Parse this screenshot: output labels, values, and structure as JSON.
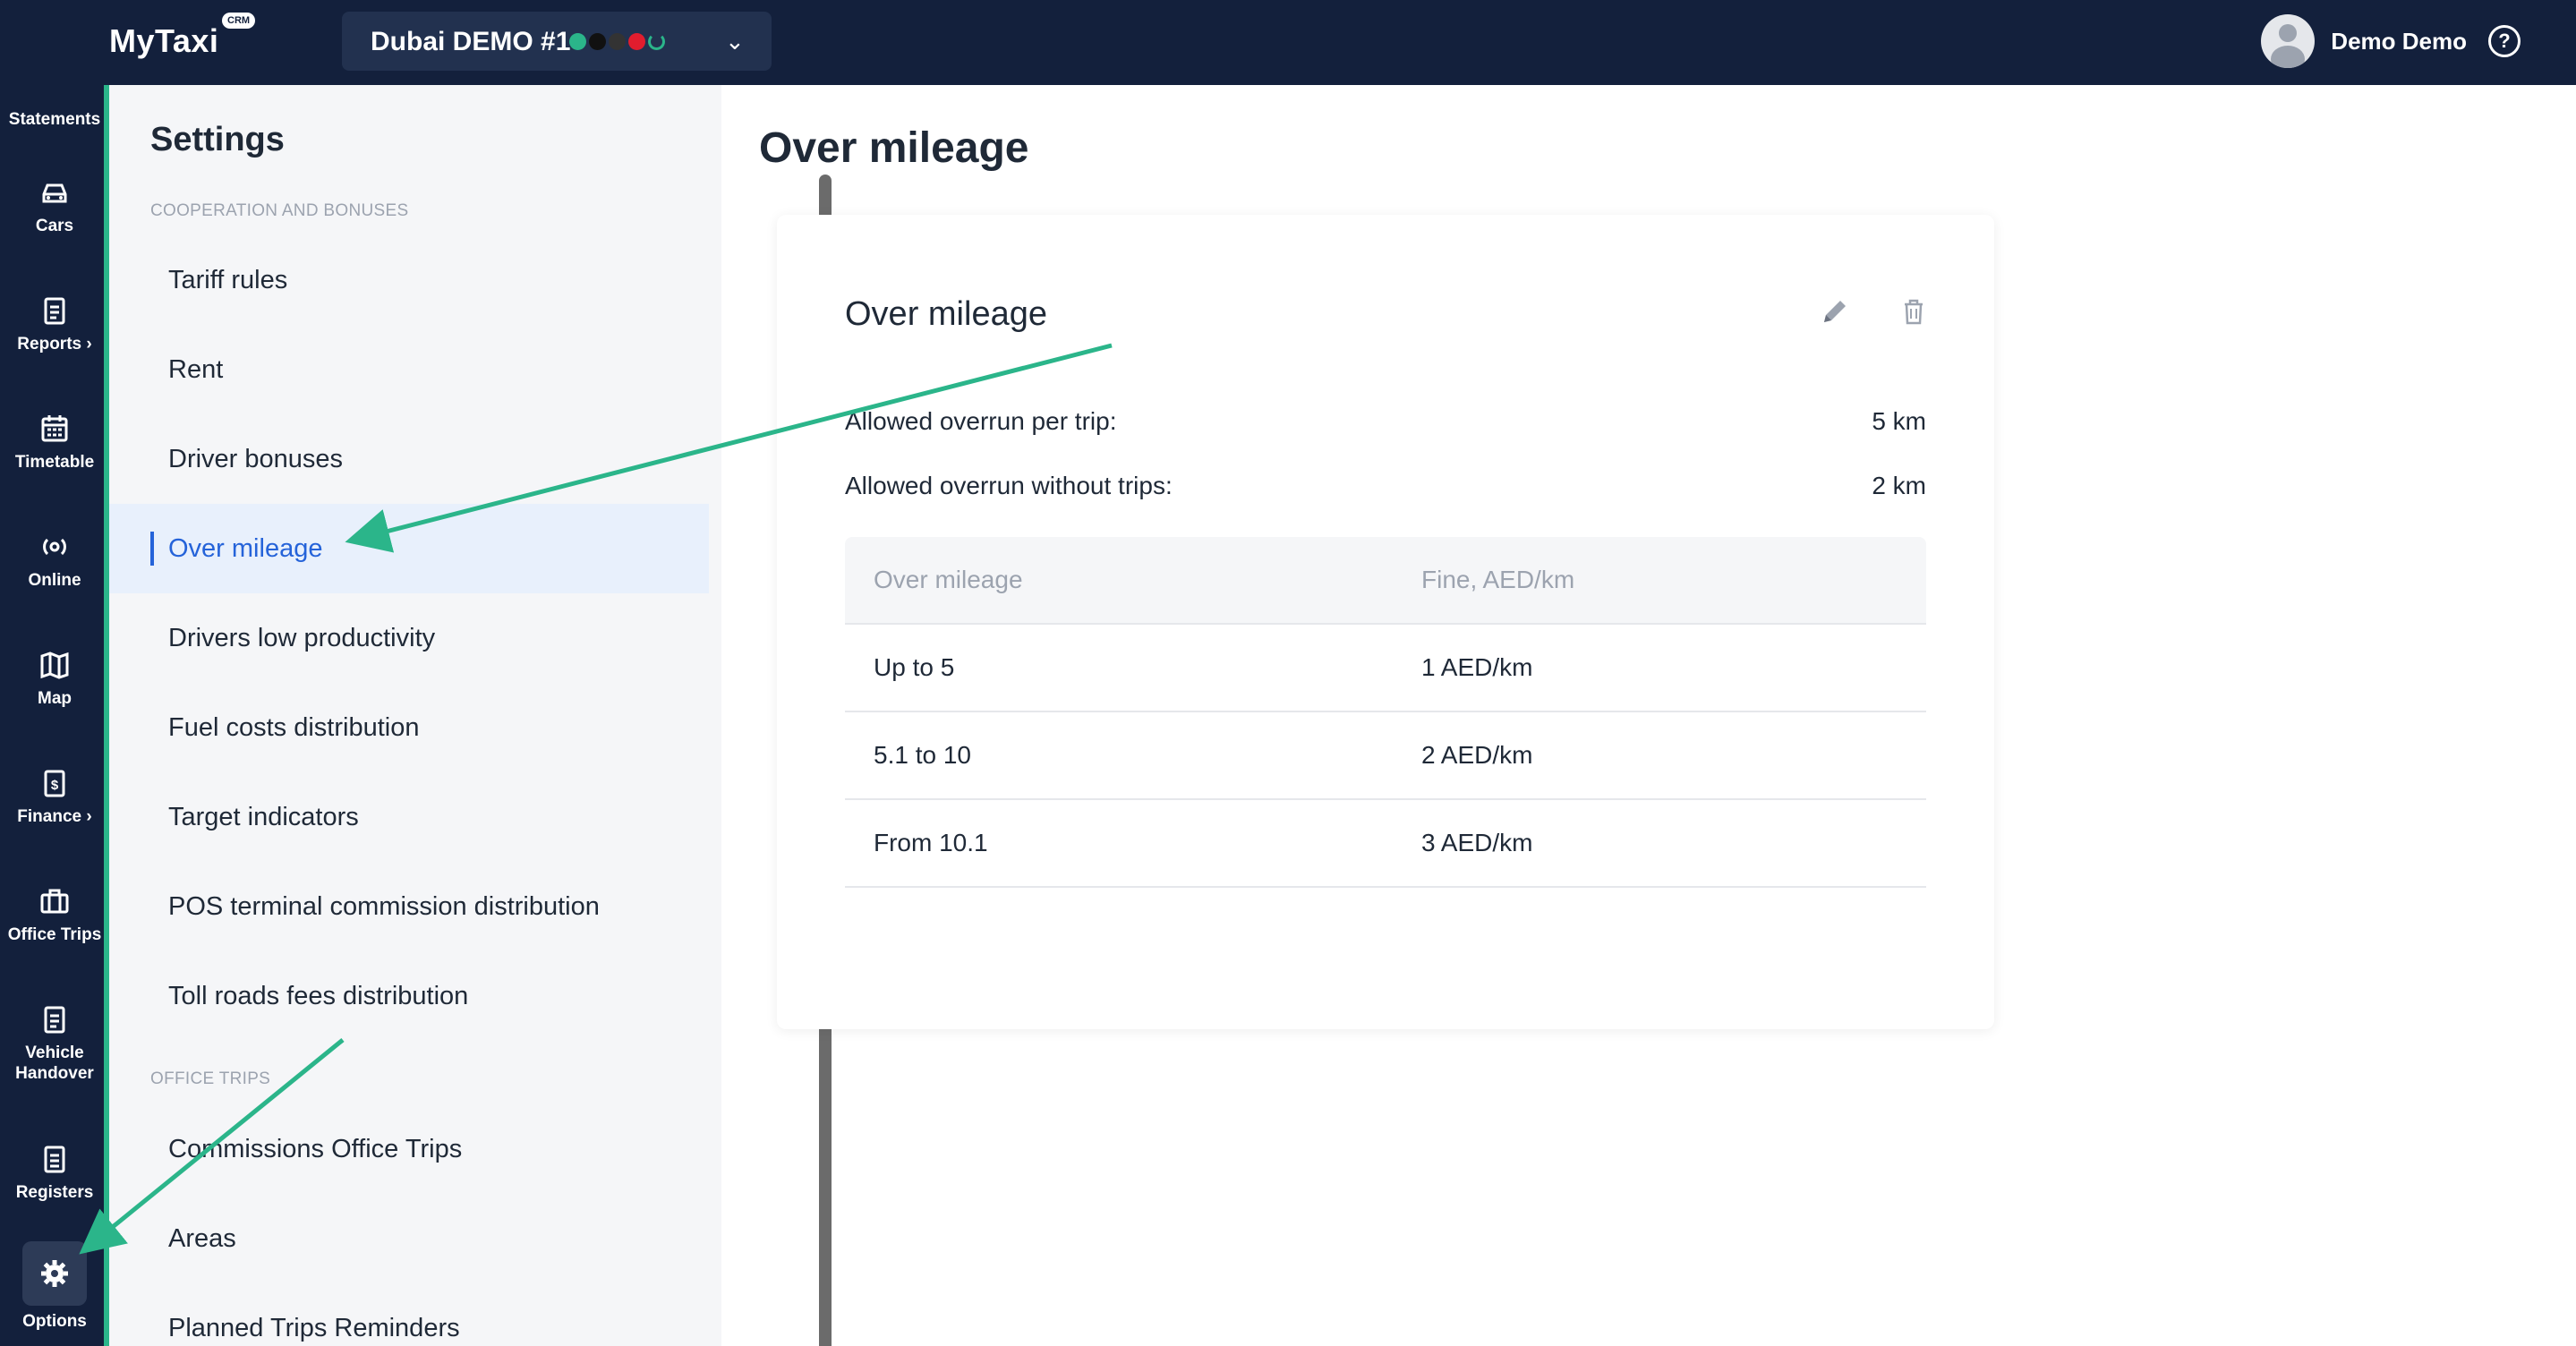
{
  "header": {
    "logo": "MyTaxi",
    "logo_badge": "CRM",
    "company": "Dubai DEMO #1",
    "status_dot_colors": [
      "#2bb58a",
      "#111111",
      "#333333",
      "#e11d2e",
      "#2bb58a"
    ],
    "user_name": "Demo Demo"
  },
  "rail": {
    "items": [
      {
        "label": "Statements",
        "icon": "document-icon"
      },
      {
        "label": "Cars",
        "icon": "car-icon"
      },
      {
        "label": "Reports ›",
        "icon": "clipboard-icon"
      },
      {
        "label": "Timetable",
        "icon": "calendar-icon"
      },
      {
        "label": "Online",
        "icon": "broadcast-icon"
      },
      {
        "label": "Map",
        "icon": "map-pin-icon"
      },
      {
        "label": "Finance ›",
        "icon": "dollar-document-icon"
      },
      {
        "label": "Office Trips",
        "icon": "briefcase-icon"
      },
      {
        "label": "Vehicle Handover",
        "icon": "clipboard-icon"
      },
      {
        "label": "Registers",
        "icon": "list-clipboard-icon"
      },
      {
        "label": "Options",
        "icon": "gear-icon"
      }
    ]
  },
  "settings": {
    "title": "Settings",
    "section_cooperation": "COOPERATION AND BONUSES",
    "section_office": "OFFICE TRIPS",
    "items": [
      "Tariff rules",
      "Rent",
      "Driver bonuses",
      "Over mileage",
      "Drivers low productivity",
      "Fuel costs distribution",
      "Target indicators",
      "POS terminal commission distribution",
      "Toll roads fees distribution"
    ],
    "office_items": [
      "Commissions Office Trips",
      "Areas",
      "Planned Trips Reminders"
    ]
  },
  "main": {
    "page_title": "Over mileage",
    "card_title": "Over mileage",
    "rows": [
      {
        "label": "Allowed overrun per trip:",
        "value": "5 km"
      },
      {
        "label": "Allowed overrun without trips:",
        "value": "2 km"
      }
    ],
    "table": {
      "headers": [
        "Over mileage",
        "Fine, AED/km"
      ],
      "rows": [
        [
          "Up to 5",
          "1 AED/km"
        ],
        [
          "5.1 to 10",
          "2 AED/km"
        ],
        [
          "From 10.1",
          "3 AED/km"
        ]
      ]
    }
  },
  "colors": {
    "nav_bg": "#13203c",
    "accent_green": "#2bb58a",
    "active_blue": "#2563d9"
  }
}
